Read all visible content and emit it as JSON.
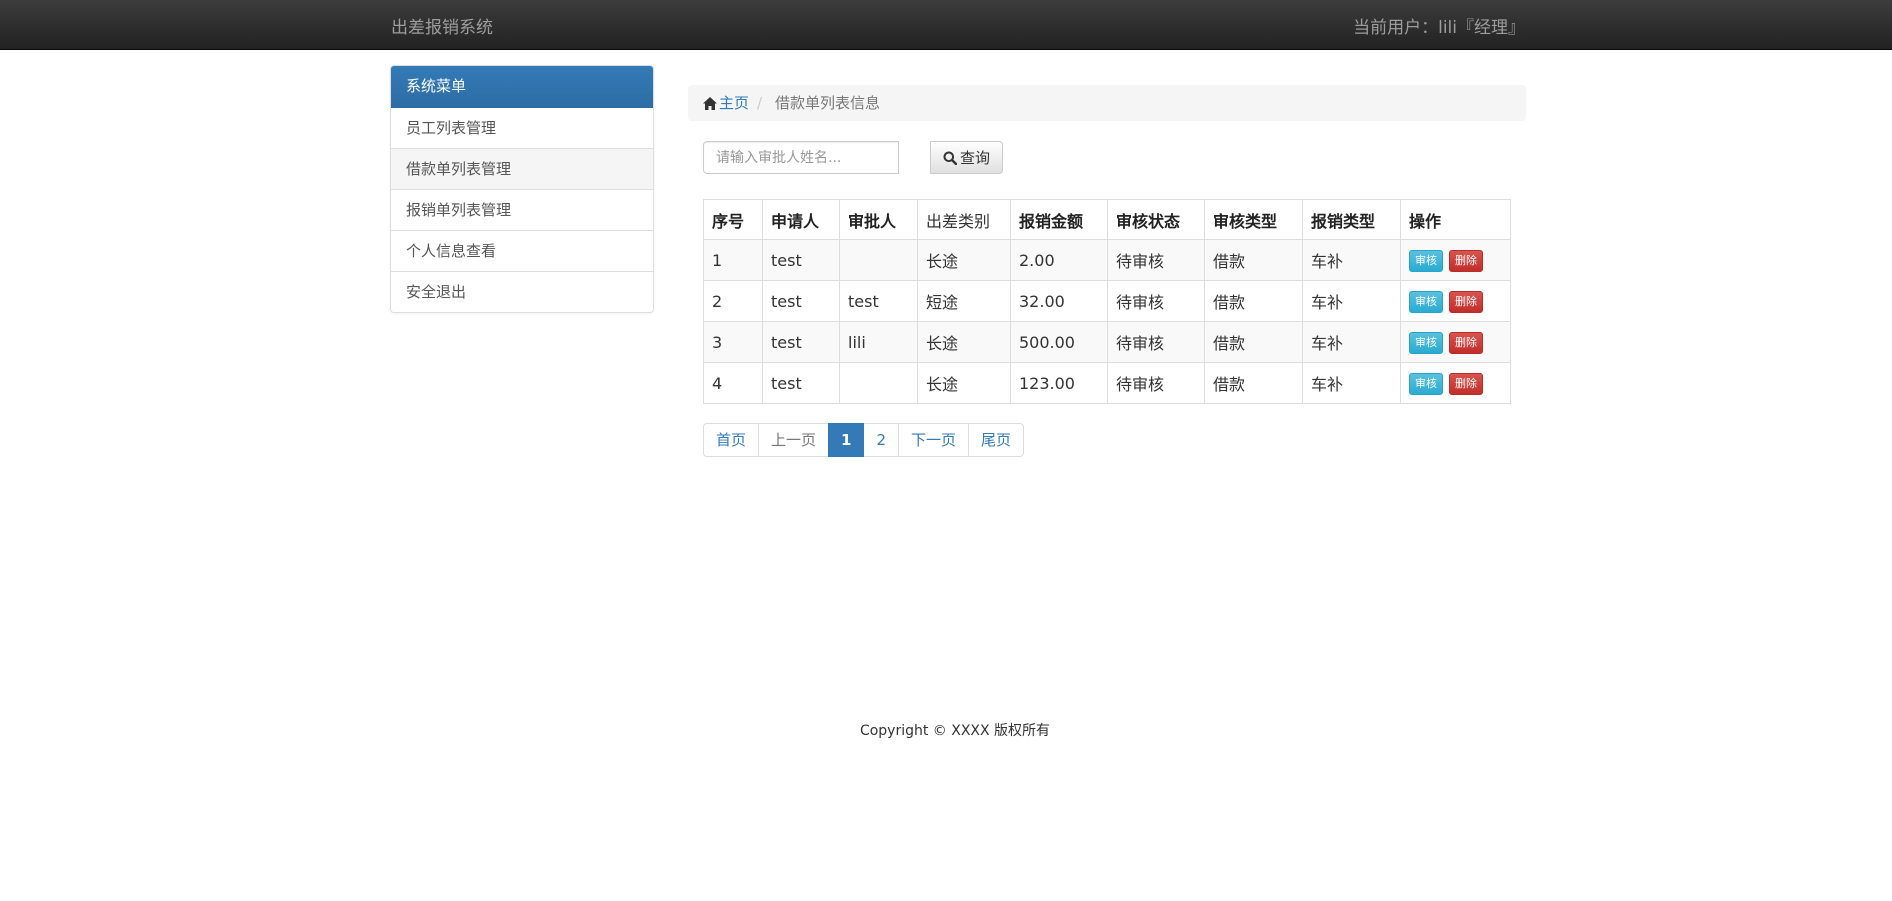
{
  "navbar": {
    "brand": "出差报销系统",
    "current_user": "当前用户：lili『经理』"
  },
  "sidebar": {
    "title": "系统菜单",
    "items": [
      {
        "label": "员工列表管理"
      },
      {
        "label": "借款单列表管理"
      },
      {
        "label": "报销单列表管理"
      },
      {
        "label": "个人信息查看"
      },
      {
        "label": "安全退出"
      }
    ]
  },
  "breadcrumb": {
    "home": "主页",
    "separator": "/",
    "current": "借款单列表信息"
  },
  "search": {
    "placeholder": "请输入审批人姓名...",
    "button_label": "查询"
  },
  "table": {
    "headers": [
      "序号",
      "申请人",
      "审批人",
      "出差类别",
      "报销金额",
      "审核状态",
      "审核类型",
      "报销类型",
      "操作"
    ],
    "rows": [
      {
        "id": "1",
        "applicant": "test",
        "approver": "",
        "category": "长途",
        "amount": "2.00",
        "status": "待审核",
        "audit_type": "借款",
        "reimburse_type": "车补"
      },
      {
        "id": "2",
        "applicant": "test",
        "approver": "test",
        "category": "短途",
        "amount": "32.00",
        "status": "待审核",
        "audit_type": "借款",
        "reimburse_type": "车补"
      },
      {
        "id": "3",
        "applicant": "test",
        "approver": "lili",
        "category": "长途",
        "amount": "500.00",
        "status": "待审核",
        "audit_type": "借款",
        "reimburse_type": "车补"
      },
      {
        "id": "4",
        "applicant": "test",
        "approver": "",
        "category": "长途",
        "amount": "123.00",
        "status": "待审核",
        "audit_type": "借款",
        "reimburse_type": "车补"
      }
    ],
    "action_audit": "审核",
    "action_delete": "删除"
  },
  "pagination": {
    "first": "首页",
    "prev": "上一页",
    "pages": [
      "1",
      "2"
    ],
    "active_page": "1",
    "next": "下一页",
    "last": "尾页"
  },
  "footer": {
    "copyright": "Copyright © XXXX 版权所有"
  },
  "colors": {
    "primary": "#337ab7",
    "info": "#5bc0de",
    "danger": "#d9534f",
    "navbar": "#222222"
  }
}
